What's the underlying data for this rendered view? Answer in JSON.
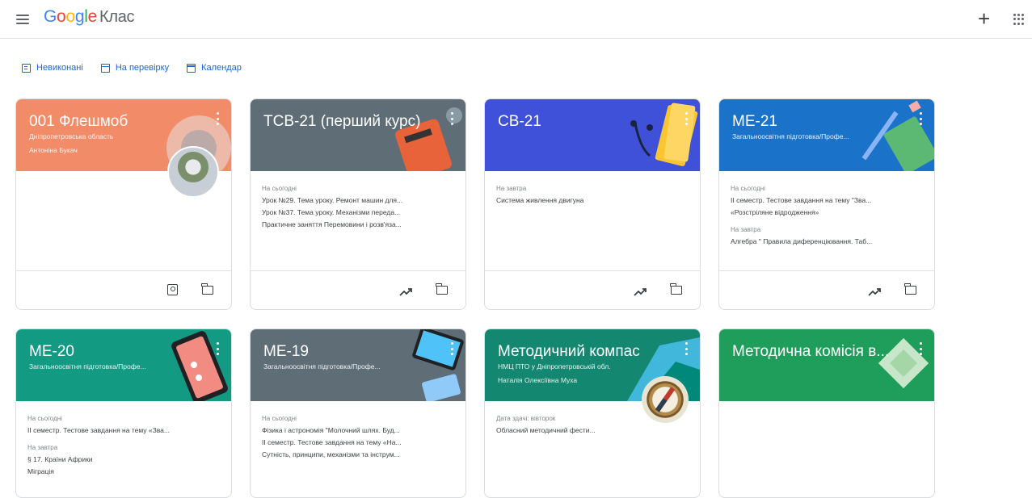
{
  "header": {
    "logo_parts": [
      "G",
      "o",
      "o",
      "g",
      "l",
      "e"
    ],
    "product": "Клас"
  },
  "shortcuts": [
    {
      "label": "Невиконані",
      "icon": "todo-icon"
    },
    {
      "label": "На перевірку",
      "icon": "review-icon"
    },
    {
      "label": "Календар",
      "icon": "calendar-icon"
    }
  ],
  "cards": [
    {
      "title": "001 Флешмоб",
      "section": "Дніпропетровська область",
      "owner": "Антоніна Букач",
      "color": "#f28b67",
      "blocks": [],
      "footer": [
        "portfolio-icon",
        "folder-icon"
      ]
    },
    {
      "title": "ТСВ-21 (перший курс)",
      "section": "",
      "owner": "",
      "color": "#5f6d76",
      "blocks": [
        {
          "label": "На сьогодні",
          "items": [
            "Урок №29. Тема уроку. Ремонт машин для...",
            "Урок №37. Тема уроку. Механізми переда...",
            "Практичне заняття Перемовини і розв'яза..."
          ]
        }
      ],
      "footer": [
        "trend-icon",
        "folder-icon"
      ]
    },
    {
      "title": "СВ-21",
      "section": "",
      "owner": "",
      "color": "#3f51d8",
      "blocks": [
        {
          "label": "На завтра",
          "items": [
            "Система живлення двигуна"
          ]
        }
      ],
      "footer": [
        "trend-icon",
        "folder-icon"
      ]
    },
    {
      "title": "МЕ-21",
      "section": "Загальноосвітня підготовка/Профе...",
      "owner": "",
      "color": "#1a73c8",
      "blocks": [
        {
          "label": "На сьогодні",
          "items": [
            "ІІ семестр. Тестове завдання на тему \"Зва...",
            "«Розстріляне відродження»"
          ]
        },
        {
          "label": "На завтра",
          "items": [
            "Алгебра \" Правила диференціювання. Таб..."
          ]
        }
      ],
      "footer": [
        "trend-icon",
        "folder-icon"
      ]
    },
    {
      "title": "МЕ-20",
      "section": "Загальноосвітня підготовка/Профе...",
      "owner": "",
      "color": "#129a82",
      "blocks": [
        {
          "label": "На сьогодні",
          "items": [
            "ІІ семестр. Тестове завдання на тему «Зва..."
          ]
        },
        {
          "label": "На завтра",
          "items": [
            "§ 17. Країни Африки",
            "Міграція"
          ]
        }
      ],
      "footer": []
    },
    {
      "title": "МЕ-19",
      "section": "Загальноосвітня підготовка/Профе...",
      "owner": "",
      "color": "#5f6d76",
      "blocks": [
        {
          "label": "На сьогодні",
          "items": [
            "Фізика і астрономія \"Молочний шлях. Буд...",
            "ІІ семестр. Тестове завдання на тему «На...",
            "Сутність, принципи, механізми та інструм..."
          ]
        }
      ],
      "footer": []
    },
    {
      "title": "Методичний компас",
      "section": "НМЦ ПТО у Дніпропетровській обл.",
      "owner": "Наталія Олексіївна Муха",
      "color": "#13876f",
      "blocks": [
        {
          "label": "Дата здачі: вівторок",
          "items": [
            "Обласний методичний фести..."
          ]
        }
      ],
      "footer": []
    },
    {
      "title": "Методична комісія в...",
      "section": "",
      "owner": "",
      "color": "#1f9d5a",
      "blocks": [],
      "footer": []
    }
  ]
}
